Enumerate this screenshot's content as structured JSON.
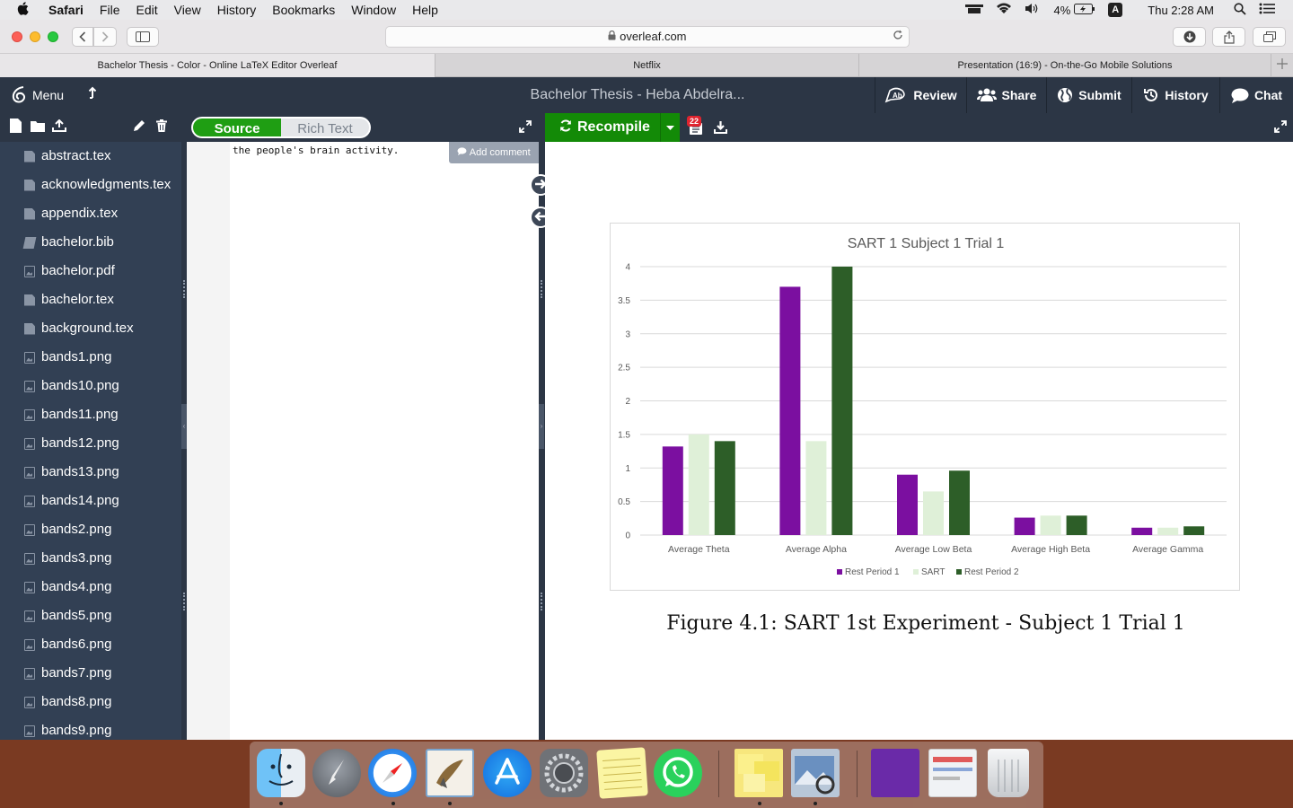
{
  "menubar": {
    "apple": "",
    "app": "Safari",
    "items": [
      "File",
      "Edit",
      "View",
      "History",
      "Bookmarks",
      "Window",
      "Help"
    ],
    "battery": "4%",
    "input": "A",
    "clock": "Thu 2:28 AM"
  },
  "browser": {
    "url": "overleaf.com",
    "tabs": [
      {
        "label": "Bachelor Thesis - Color - Online LaTeX Editor Overleaf"
      },
      {
        "label": "Netflix"
      },
      {
        "label": "Presentation (16:9) - On-the-Go Mobile Solutions"
      }
    ]
  },
  "overleaf": {
    "menu_label": "Menu",
    "project_title": "Bachelor Thesis - Heba Abdelra...",
    "header_buttons": {
      "review": "Review",
      "share": "Share",
      "submit": "Submit",
      "history": "History",
      "chat": "Chat"
    },
    "files": [
      {
        "name": "abstract.tex",
        "type": "doc"
      },
      {
        "name": "acknowledgments.tex",
        "type": "doc"
      },
      {
        "name": "appendix.tex",
        "type": "doc"
      },
      {
        "name": "bachelor.bib",
        "type": "bib"
      },
      {
        "name": "bachelor.pdf",
        "type": "img"
      },
      {
        "name": "bachelor.tex",
        "type": "doc"
      },
      {
        "name": "background.tex",
        "type": "doc"
      },
      {
        "name": "bands1.png",
        "type": "img"
      },
      {
        "name": "bands10.png",
        "type": "img"
      },
      {
        "name": "bands11.png",
        "type": "img"
      },
      {
        "name": "bands12.png",
        "type": "img"
      },
      {
        "name": "bands13.png",
        "type": "img"
      },
      {
        "name": "bands14.png",
        "type": "img"
      },
      {
        "name": "bands2.png",
        "type": "img"
      },
      {
        "name": "bands3.png",
        "type": "img"
      },
      {
        "name": "bands4.png",
        "type": "img"
      },
      {
        "name": "bands5.png",
        "type": "img"
      },
      {
        "name": "bands6.png",
        "type": "img"
      },
      {
        "name": "bands7.png",
        "type": "img"
      },
      {
        "name": "bands8.png",
        "type": "img"
      },
      {
        "name": "bands9.png",
        "type": "img"
      }
    ],
    "editor": {
      "source_label": "Source",
      "rich_text_label": "Rich Text",
      "code_line": "the people's brain activity.",
      "add_comment": "Add comment"
    },
    "pdf": {
      "recompile_label": "Recompile",
      "log_badge": "22",
      "caption": "Figure 4.1: SART 1st Experiment - Subject 1 Trial 1"
    }
  },
  "chart_data": {
    "type": "bar",
    "title": "SART 1  Subject 1 Trial 1",
    "categories": [
      "Average Theta",
      "Average Alpha",
      "Average Low Beta",
      "Average High Beta",
      "Average Gamma"
    ],
    "series": [
      {
        "name": "Rest Period 1",
        "values": [
          1.32,
          3.7,
          0.9,
          0.26,
          0.11
        ],
        "color": "#7b0fa0"
      },
      {
        "name": "SART",
        "values": [
          1.5,
          1.4,
          0.65,
          0.29,
          0.11
        ],
        "color": "#dff0d8"
      },
      {
        "name": "Rest Period 2",
        "values": [
          1.4,
          4.0,
          0.96,
          0.29,
          0.13
        ],
        "color": "#2d5e28"
      }
    ],
    "y_ticks": [
      "0",
      "0.5",
      "1",
      "1.5",
      "2",
      "2.5",
      "3",
      "3.5",
      "4"
    ],
    "ylim": [
      0,
      4
    ],
    "grid": true,
    "legend_position": "bottom"
  },
  "colors": {
    "overleaf_dark": "#2c3645",
    "overleaf_sidebar": "#324054",
    "overleaf_green": "#138a07"
  }
}
